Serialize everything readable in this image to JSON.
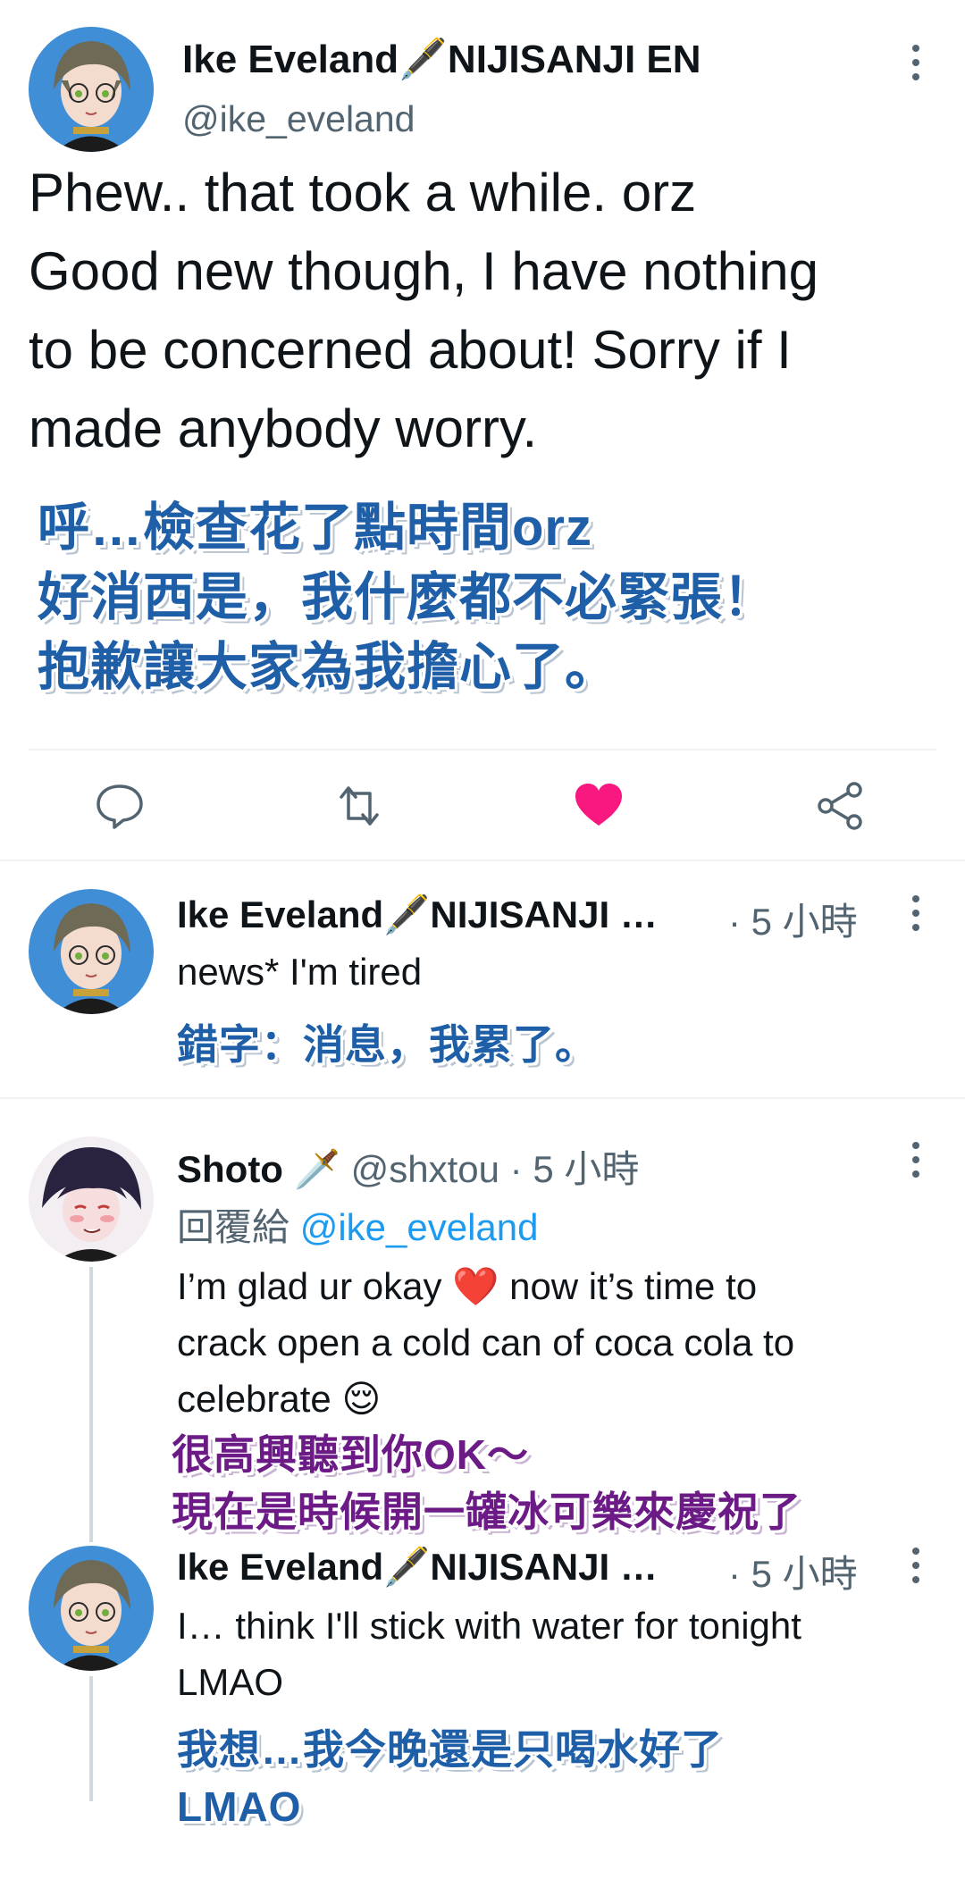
{
  "main_tweet": {
    "display_name": "Ike Eveland🖋️NIJISANJI EN",
    "handle": "@ike_eveland",
    "text_lines": [
      "Phew.. that took a while. orz",
      "Good new though, I have nothing",
      "to be concerned about! Sorry if I",
      "made anybody worry."
    ],
    "translation_lines": [
      "呼…檢查花了點時間orz",
      "好消西是，我什麼都不必緊張！",
      "抱歉讓大家為我擔心了。"
    ],
    "liked": true,
    "colors": {
      "like": "#f91880",
      "icon": "#536471"
    }
  },
  "replies": [
    {
      "display_name": "Ike Eveland🖋️NIJISANJI …",
      "time": "· 5 小時",
      "text_lines": [
        "news* I'm tired"
      ],
      "translation_lines": [
        "錯字：消息，我累了。"
      ]
    },
    {
      "display_name": "Shoto 🗡️",
      "handle": "@shxtou",
      "time": "· 5 小時",
      "reply_prefix": "回覆給",
      "reply_to": "@ike_eveland",
      "text_lines": [
        "I’m glad ur okay ❤️ now it’s time to",
        "crack open a cold can of coca cola to",
        "celebrate 😌"
      ],
      "translation_lines": [
        "很高興聽到你OK～",
        "現在是時候開一罐冰可樂來慶祝了"
      ]
    },
    {
      "display_name": "Ike Eveland🖋️NIJISANJI …",
      "time": "· 5 小時",
      "text_lines": [
        "I… think I'll stick with water for tonight",
        "LMAO"
      ],
      "translation_lines": [
        "我想…我今晚還是只喝水好了",
        "LMAO"
      ]
    }
  ]
}
